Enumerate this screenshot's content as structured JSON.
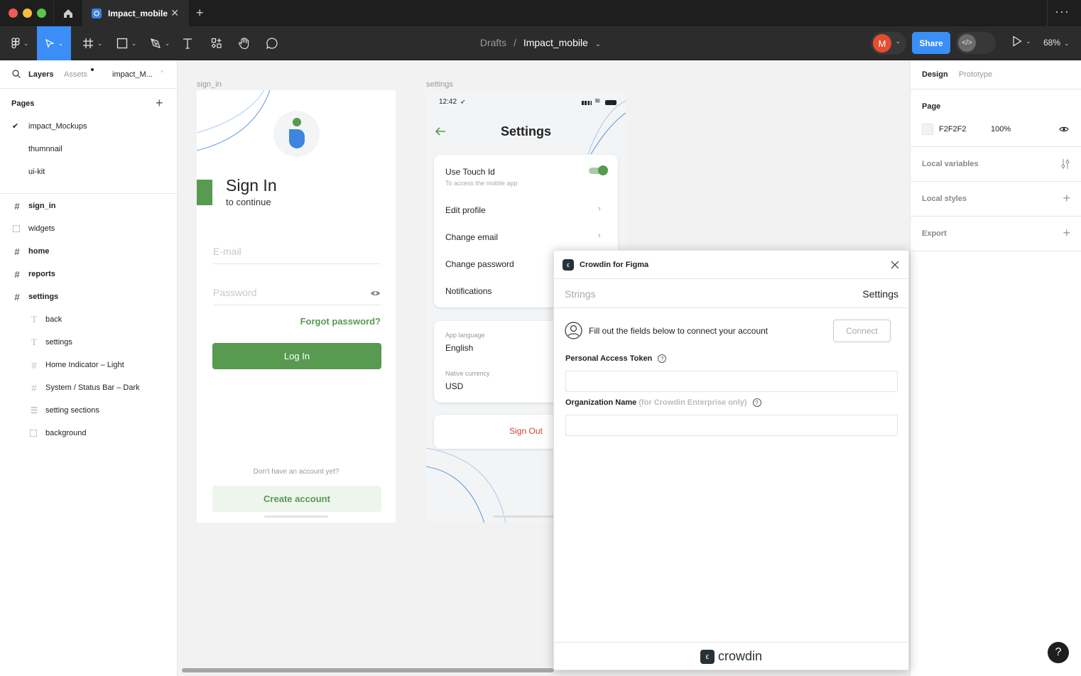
{
  "titlebar": {
    "tab_title": "Impact_mobile",
    "close_glyph": "✕",
    "new_tab_glyph": "+",
    "more_glyph": "···"
  },
  "toolbar": {
    "tools": [
      "main-menu",
      "move",
      "frame",
      "shape",
      "pen",
      "text",
      "resources",
      "hand",
      "comment"
    ],
    "breadcrumb_parent": "Drafts",
    "breadcrumb_sep": "/",
    "breadcrumb_file": "Impact_mobile",
    "avatar_initial": "M",
    "share_label": "Share",
    "dev_mode_glyph": "</>",
    "zoom_level": "68%"
  },
  "left_panel": {
    "tabs": {
      "layers": "Layers",
      "assets": "Assets",
      "file": "impact_M..."
    },
    "pages_heading": "Pages",
    "pages": [
      {
        "name": "impact_Mockups",
        "selected": true
      },
      {
        "name": "thumnnail",
        "selected": false
      },
      {
        "name": "ui-kit",
        "selected": false
      }
    ],
    "layers": [
      {
        "name": "sign_in",
        "type": "frame",
        "level": 0
      },
      {
        "name": "widgets",
        "type": "section",
        "level": 0
      },
      {
        "name": "home",
        "type": "frame",
        "level": 0
      },
      {
        "name": "reports",
        "type": "frame",
        "level": 0
      },
      {
        "name": "settings",
        "type": "frame",
        "level": 0
      },
      {
        "name": "back",
        "type": "text",
        "level": 1
      },
      {
        "name": "settings",
        "type": "text",
        "level": 1
      },
      {
        "name": "Home Indicator – Light",
        "type": "frame",
        "level": 1
      },
      {
        "name": "System / Status Bar – Dark",
        "type": "frame",
        "level": 1
      },
      {
        "name": "setting sections",
        "type": "autolayout",
        "level": 1
      },
      {
        "name": "background",
        "type": "section",
        "level": 1
      }
    ]
  },
  "right_panel": {
    "tabs": {
      "design": "Design",
      "prototype": "Prototype"
    },
    "page_heading": "Page",
    "page_color": "F2F2F2",
    "page_opacity": "100%",
    "local_variables": "Local variables",
    "local_styles": "Local styles",
    "export": "Export"
  },
  "canvas": {
    "signin_frame": {
      "label": "sign_in",
      "title": "Sign In",
      "subtitle": "to continue",
      "email_placeholder": "E-mail",
      "password_placeholder": "Password",
      "forgot": "Forgot password?",
      "login": "Log In",
      "no_account": "Don't have an account yet?",
      "create": "Create account"
    },
    "settings_frame": {
      "label": "settings",
      "time": "12:42",
      "title": "Settings",
      "touch_id_title": "Use Touch Id",
      "touch_id_sub": "To access the mobile app",
      "touch_id_on": true,
      "items": [
        "Edit profile",
        "Change email",
        "Change password",
        "Notifications"
      ],
      "app_language_label": "App language",
      "app_language_value": "English",
      "currency_label": "Native currency",
      "currency_value": "USD",
      "sign_out": "Sign Out"
    }
  },
  "plugin": {
    "title": "Crowdin for Figma",
    "tab_strings": "Strings",
    "tab_settings": "Settings",
    "connect_message": "Fill out the fields below to connect your account",
    "connect_button": "Connect",
    "token_label": "Personal Access Token",
    "token_value": "",
    "org_label": "Organization Name",
    "org_hint": "(for Crowdin Enterprise only)",
    "org_value": "",
    "footer_brand": "crowdin"
  },
  "help_button": "?",
  "colors": {
    "accent_blue": "#3a8ef6",
    "brand_green": "#579a50",
    "sign_out_red": "#d0452f",
    "avatar": "#e44d2e"
  }
}
